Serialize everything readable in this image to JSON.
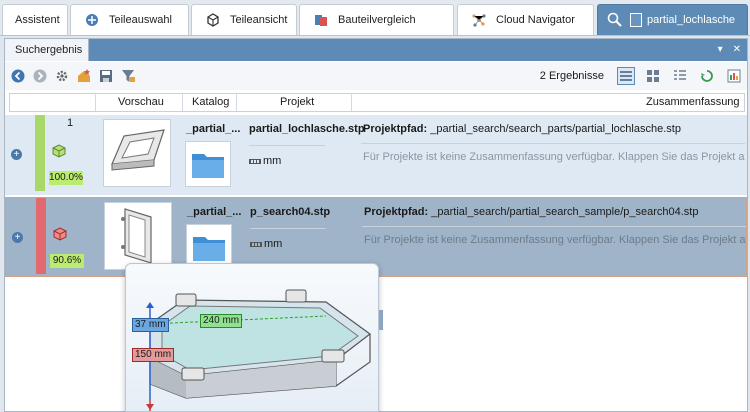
{
  "tabs": [
    {
      "label": "Assistent",
      "icon": "none"
    },
    {
      "label": "Teileauswahl",
      "icon": "parts-selection-icon"
    },
    {
      "label": "Teileansicht",
      "icon": "part-view-icon"
    },
    {
      "label": "Bauteilvergleich",
      "icon": "compare-icon"
    },
    {
      "label": "Cloud Navigator",
      "icon": "cloud-navigator-icon"
    },
    {
      "label": "partial_lochlasche",
      "icon": "search-result-icon"
    }
  ],
  "panel": {
    "title": "Suchergebnis",
    "controls": [
      "▾",
      "✕"
    ]
  },
  "toolbar": {
    "result_count": "2 Ergebnisse"
  },
  "columns": [
    "Vorschau",
    "Katalog",
    "Projekt",
    "Zusammenfassung"
  ],
  "results": [
    {
      "rank": "1",
      "percent": "100.0%",
      "color": "#a8d86a",
      "catalog": "_partial_...",
      "project": "partial_lochlasche.stp",
      "unit": "mm",
      "path_label": "Projektpfad:",
      "path": "_partial_search/search_parts/partial_lochlasche.stp",
      "summary": "Für Projekte ist keine Zusammenfassung verfügbar. Klappen Sie das Projekt auf, um die..."
    },
    {
      "rank": "",
      "percent": "90.6%",
      "color": "#e06a6e",
      "catalog": "_partial_...",
      "project": "p_search04.stp",
      "unit": "mm",
      "path_label": "Projektpfad:",
      "path": "_partial_search/partial_search_sample/p_search04.stp",
      "summary": "Für Projekte ist keine Zusammenfassung verfügbar. Klappen Sie das Projekt auf, um die..."
    }
  ],
  "preview": {
    "dim_height": "37 mm",
    "dim_width": "240 mm",
    "dim_depth": "150 mm"
  }
}
